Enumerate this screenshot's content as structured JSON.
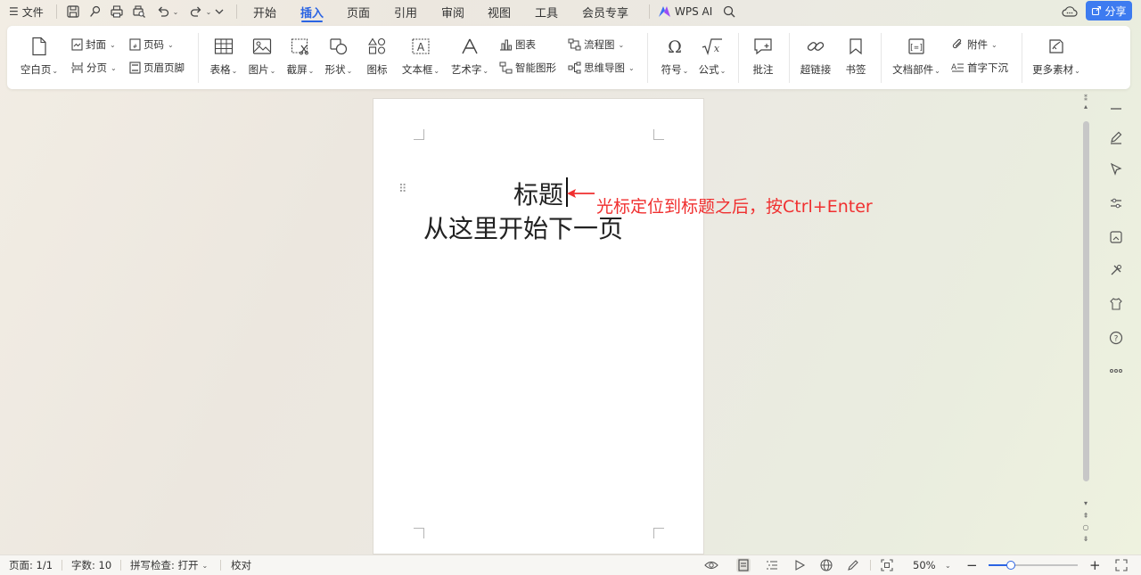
{
  "menubar": {
    "file_label": "文件",
    "tabs": [
      {
        "label": "开始",
        "active": false
      },
      {
        "label": "插入",
        "active": true
      },
      {
        "label": "页面",
        "active": false
      },
      {
        "label": "引用",
        "active": false
      },
      {
        "label": "审阅",
        "active": false
      },
      {
        "label": "视图",
        "active": false
      },
      {
        "label": "工具",
        "active": false
      },
      {
        "label": "会员专享",
        "active": false
      }
    ],
    "wps_ai_label": "WPS AI",
    "share_label": "分享",
    "accent_color": "#2b64e3"
  },
  "ribbon": {
    "blank_page": "空白页",
    "cover": "封面",
    "page_break": "分页",
    "page_number": "页码",
    "header_footer": "页眉页脚",
    "table": "表格",
    "picture": "图片",
    "screenshot": "截屏",
    "shape": "形状",
    "icon": "图标",
    "textbox": "文本框",
    "wordart": "艺术字",
    "chart": "图表",
    "smart_graphic": "智能图形",
    "flowchart": "流程图",
    "mindmap": "思维导图",
    "symbol": "符号",
    "formula": "公式",
    "comment": "批注",
    "hyperlink": "超链接",
    "bookmark": "书签",
    "doc_parts": "文档部件",
    "attachment": "附件",
    "drop_cap": "首字下沉",
    "more_materials": "更多素材"
  },
  "document": {
    "title": "标题",
    "line2": "从这里开始下一页"
  },
  "annotation": {
    "text": "光标定位到标题之后，按Ctrl+Enter",
    "color": "#f02f2f"
  },
  "statusbar": {
    "page": "页面: 1/1",
    "word_count": "字数: 10",
    "spellcheck": "拼写检查: 打开",
    "proofread": "校对",
    "zoom": "50%",
    "zoom_fraction": 0.25
  }
}
